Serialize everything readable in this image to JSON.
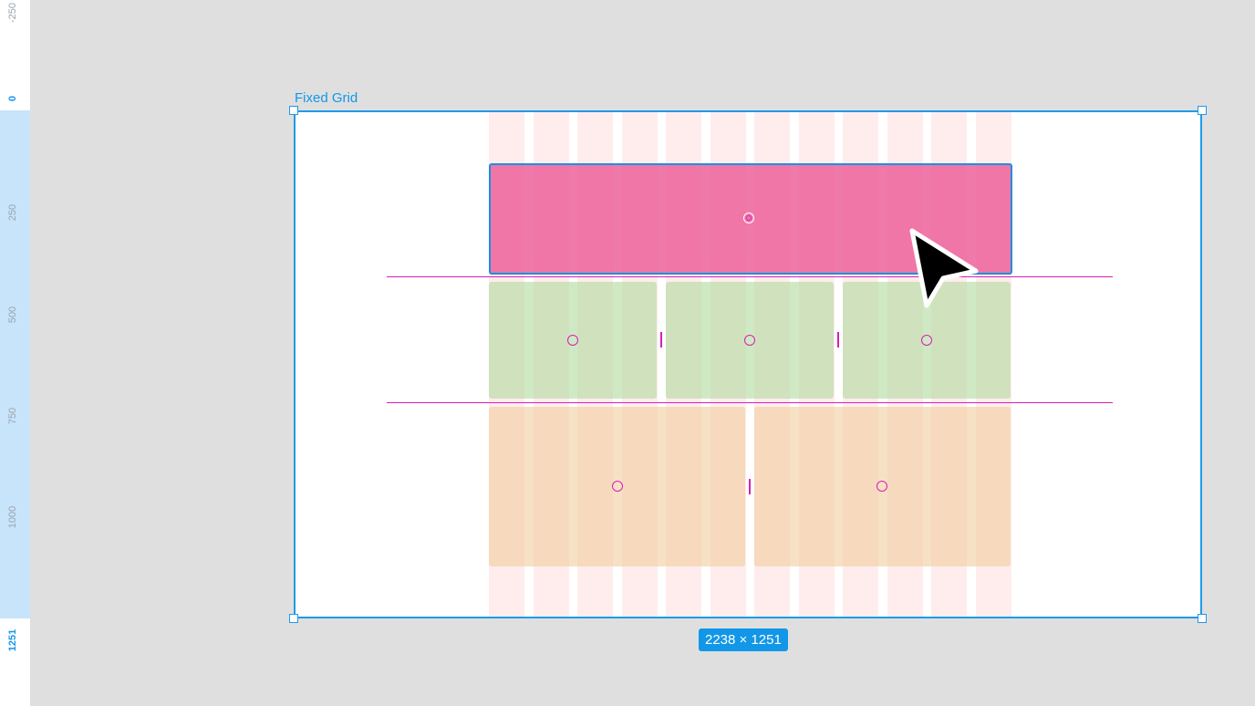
{
  "ruler": {
    "labels": [
      "-250",
      "0",
      "250",
      "500",
      "750",
      "1000",
      "1251"
    ]
  },
  "frame": {
    "title": "Fixed Grid",
    "dimensions": "2238 × 1251"
  },
  "colors": {
    "selection": "#1e9be8",
    "pink_block": "#ee7aa7",
    "green_block": "#cde6c2",
    "orange_block": "#f5dec0",
    "guide": "#d61fb5",
    "column": "#fde9e9"
  },
  "icons": {
    "cursor": "arrow-cursor-icon",
    "center": "center-point-icon",
    "handle": "resize-handle-icon"
  }
}
